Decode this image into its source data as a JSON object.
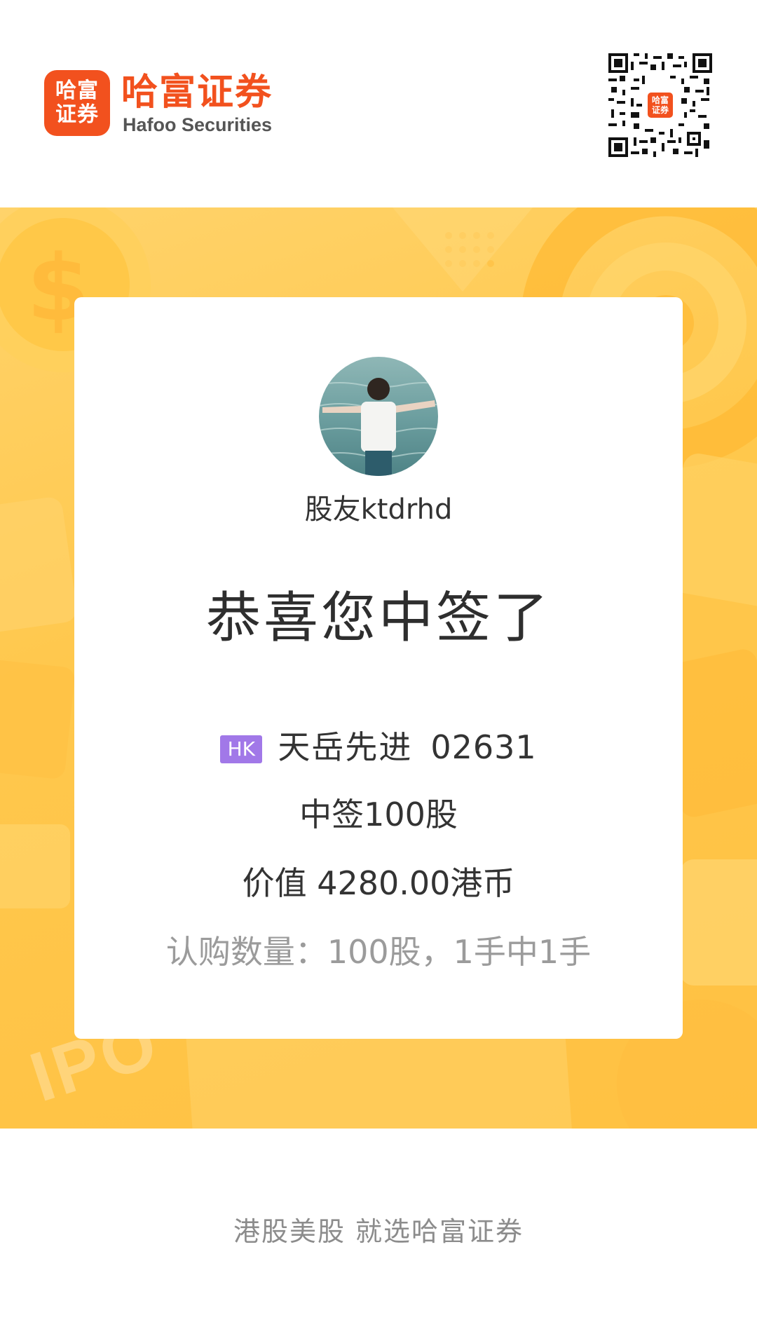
{
  "header": {
    "logo_badge_line1": "哈富",
    "logo_badge_line2": "证券",
    "brand_name_cn": "哈富证券",
    "brand_name_en": "Hafoo Securities",
    "qr_center_line1": "哈富",
    "qr_center_line2": "证券"
  },
  "banner": {
    "watermark": "IPO"
  },
  "card": {
    "username": "股友ktdrhd",
    "headline": "恭喜您中签了",
    "market_badge": "HK",
    "stock_name": "天岳先进",
    "stock_code": "02631",
    "allotment": "中签100股",
    "value": "价值 4280.00港币",
    "subscription": "认购数量：100股，1手中1手"
  },
  "footer": {
    "slogan": "港股美股 就选哈富证券"
  },
  "colors": {
    "brand_orange": "#f2511e",
    "banner_yellow": "#ffc84d",
    "hk_badge": "#a178e8",
    "text_dark": "#333333",
    "text_muted": "#9b9b9b"
  },
  "icons": {
    "qr_code": "qr-code-icon",
    "avatar": "user-avatar-photo",
    "dollar": "dollar-coin-icon"
  }
}
